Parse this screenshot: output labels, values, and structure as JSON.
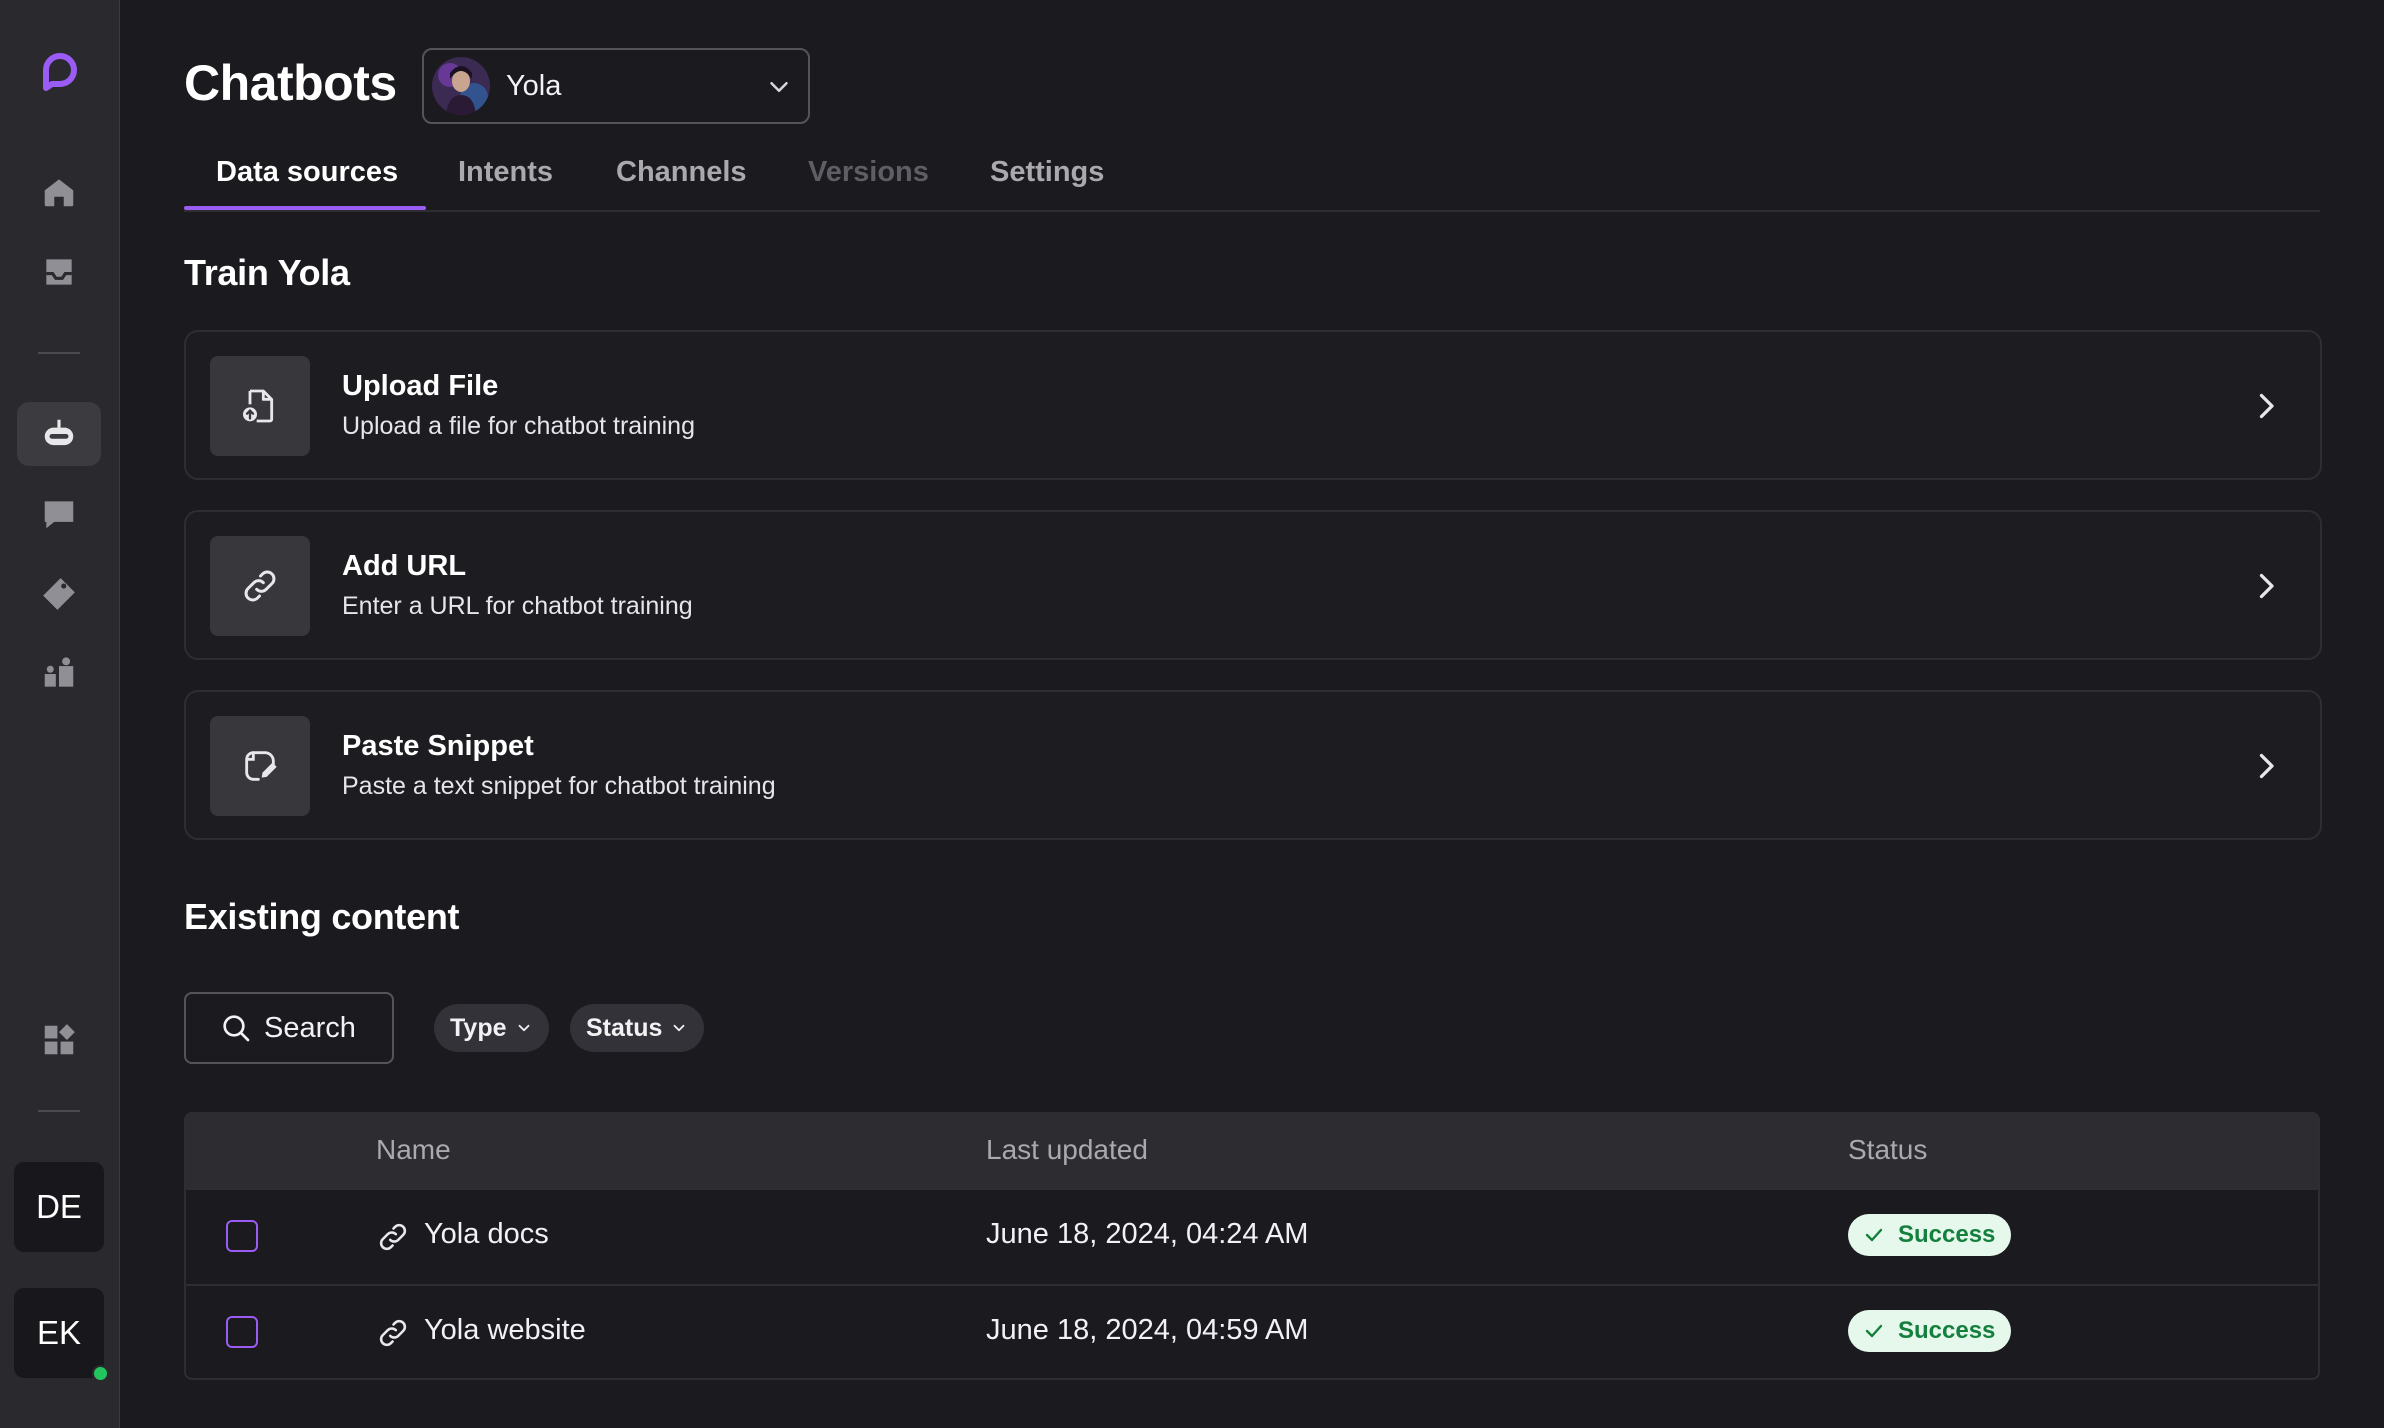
{
  "header": {
    "title": "Chatbots",
    "bot_selector": {
      "selected": "Yola"
    }
  },
  "tabs": [
    {
      "label": "Data sources",
      "state": "active"
    },
    {
      "label": "Intents",
      "state": "normal"
    },
    {
      "label": "Channels",
      "state": "normal"
    },
    {
      "label": "Versions",
      "state": "disabled"
    },
    {
      "label": "Settings",
      "state": "normal"
    }
  ],
  "train": {
    "title": "Train Yola",
    "cards": [
      {
        "title": "Upload File",
        "subtitle": "Upload a file for chatbot training",
        "icon": "upload-file-icon"
      },
      {
        "title": "Add URL",
        "subtitle": "Enter a URL for chatbot training",
        "icon": "link-icon"
      },
      {
        "title": "Paste Snippet",
        "subtitle": "Paste a text snippet for chatbot training",
        "icon": "snippet-icon"
      }
    ]
  },
  "existing": {
    "title": "Existing content",
    "search_label": "Search",
    "filters": [
      "Type",
      "Status"
    ],
    "columns": {
      "name": "Name",
      "updated": "Last updated",
      "status": "Status"
    },
    "rows": [
      {
        "name": "Yola docs",
        "updated": "June 18, 2024, 04:24 AM",
        "status": "Success"
      },
      {
        "name": "Yola website",
        "updated": "June 18, 2024, 04:59 AM",
        "status": "Success"
      }
    ]
  },
  "sidebar": {
    "items": [
      "home-icon",
      "inbox-icon",
      "chatbot-icon",
      "chat-icon",
      "ticket-icon",
      "team-icon",
      "apps-icon"
    ],
    "active": "chatbot-icon",
    "avatars": [
      "DE",
      "EK"
    ]
  },
  "colors": {
    "accent": "#9b5cf6",
    "background": "#1b1a1f",
    "sidebar": "#2a2a2e",
    "success_bg": "#e6f8ec",
    "success_text": "#15803d",
    "online": "#22c55e"
  }
}
